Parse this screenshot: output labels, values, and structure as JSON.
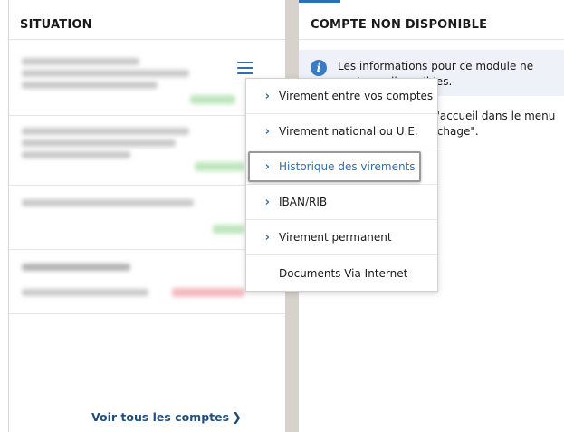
{
  "left_panel": {
    "title": "SITUATION",
    "voir_link": "Voir tous les comptes"
  },
  "right_panel": {
    "title": "COMPTE NON DISPONIBLE",
    "info_text": "Les informations pour ce module ne sont pas disponibles.",
    "body_text": "Modifiez la page d'accueil dans le menu \"Préférences d'affichage\"."
  },
  "menu": {
    "items": [
      {
        "label": "Virement entre vos comptes",
        "arrow": true
      },
      {
        "label": "Virement national ou U.E.",
        "arrow": true
      },
      {
        "label": "Historique des virements",
        "arrow": true,
        "highlighted": true
      },
      {
        "label": "IBAN/RIB",
        "arrow": true
      },
      {
        "label": "Virement permanent",
        "arrow": true
      },
      {
        "label": "Documents Via Internet",
        "arrow": false
      }
    ]
  },
  "colors": {
    "accent": "#2f6fb3",
    "link": "#1f4f82",
    "info_bg": "#eef1f7",
    "divider": "#d8d2cc"
  },
  "icons": {
    "menu": "hamburger-icon",
    "info": "info-icon",
    "chevron": "chevron-right-icon"
  }
}
